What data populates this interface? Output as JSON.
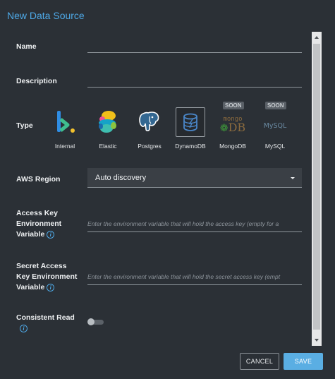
{
  "dialog": {
    "title": "New Data Source"
  },
  "fields": {
    "name": {
      "label": "Name",
      "value": ""
    },
    "description": {
      "label": "Description",
      "value": ""
    },
    "type": {
      "label": "Type",
      "selected": "DynamoDB",
      "options": [
        {
          "label": "Internal",
          "icon": "bubble-logo-icon",
          "badge": ""
        },
        {
          "label": "Elastic",
          "icon": "elastic-logo-icon",
          "badge": ""
        },
        {
          "label": "Postgres",
          "icon": "postgres-elephant-icon",
          "badge": ""
        },
        {
          "label": "DynamoDB",
          "icon": "dynamodb-logo-icon",
          "badge": ""
        },
        {
          "label": "MongoDB",
          "icon": "mongodb-logo-icon",
          "badge": "SOON",
          "logo_top": "mongo",
          "logo_bottom": "DB"
        },
        {
          "label": "MySQL",
          "icon": "mysql-logo-icon",
          "badge": "SOON",
          "logo_text": "MySQL"
        }
      ]
    },
    "aws_region": {
      "label": "AWS Region",
      "value": "Auto discovery"
    },
    "access_key": {
      "label_lines": [
        "Access Key",
        "Environment",
        "Variable"
      ],
      "placeholder": "Enter the environment variable that will hold the access key (empty for a"
    },
    "secret_key": {
      "label_lines": [
        "Secret Access",
        "Key Environment",
        "Variable"
      ],
      "placeholder": "Enter the environment variable that will hold the secret access key (empt"
    },
    "consistent_read": {
      "label": "Consistent Read",
      "value": false
    }
  },
  "info_icon_glyph": "i",
  "buttons": {
    "cancel": "CANCEL",
    "save": "SAVE"
  },
  "colors": {
    "background": "#2b3036",
    "accent": "#4ea8e6",
    "save_button": "#5aaee3"
  }
}
